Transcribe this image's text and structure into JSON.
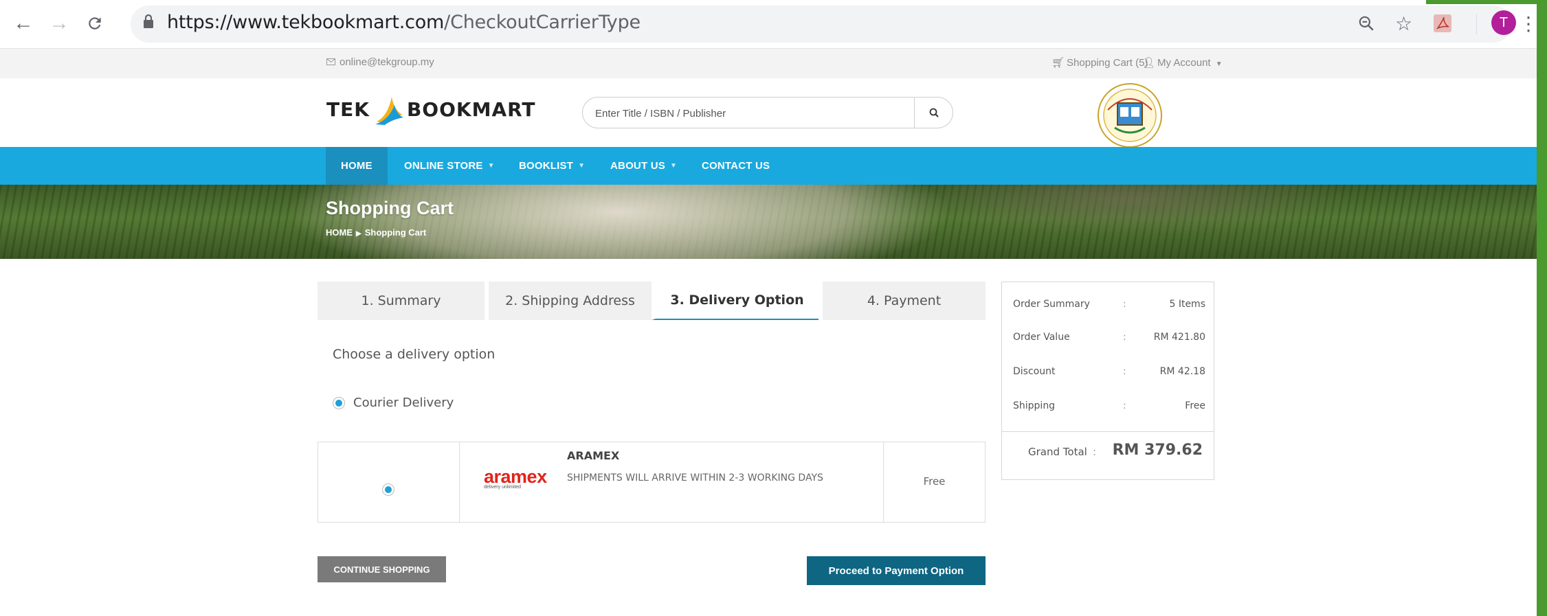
{
  "browser": {
    "url_host": "https://www.tekbookmart.com",
    "url_path": "/CheckoutCarrierType",
    "avatar_letter": "T"
  },
  "topbar": {
    "email": "online@tekgroup.my",
    "cart_link": "Shopping Cart (5)",
    "account_link": "My Account"
  },
  "header": {
    "logo_text_left": "TEK",
    "logo_text_right": "BOOKMART",
    "search_placeholder": "Enter Title / ISBN / Publisher"
  },
  "nav": {
    "items": [
      {
        "label": "HOME",
        "dropdown": false
      },
      {
        "label": "ONLINE STORE",
        "dropdown": true
      },
      {
        "label": "BOOKLIST",
        "dropdown": true
      },
      {
        "label": "ABOUT US",
        "dropdown": true
      },
      {
        "label": "CONTACT US",
        "dropdown": false
      }
    ]
  },
  "banner": {
    "title": "Shopping Cart",
    "crumb_home": "HOME",
    "crumb_current": "Shopping Cart"
  },
  "steps": [
    {
      "label": "1. Summary",
      "active": false
    },
    {
      "label": "2. Shipping Address",
      "active": false
    },
    {
      "label": "3. Delivery Option",
      "active": true
    },
    {
      "label": "4. Payment",
      "active": false
    }
  ],
  "delivery": {
    "heading": "Choose a delivery option",
    "option_label": "Courier Delivery",
    "carrier": {
      "logo_word": "aramex",
      "logo_tagline": "delivery unlimited",
      "name": "ARAMEX",
      "description": "SHIPMENTS WILL ARRIVE WITHIN 2-3 WORKING DAYS",
      "price": "Free"
    }
  },
  "buttons": {
    "continue": "CONTINUE SHOPPING",
    "proceed": "Proceed to Payment Option"
  },
  "summary": {
    "rows": [
      {
        "label": "Order Summary",
        "value": "5 Items"
      },
      {
        "label": "Order Value",
        "value": "RM 421.80"
      },
      {
        "label": "Discount",
        "value": "RM 42.18"
      },
      {
        "label": "Shipping",
        "value": "Free"
      }
    ],
    "colon": ":",
    "grand_label": "Grand Total",
    "grand_value": "RM 379.62"
  },
  "colors": {
    "nav_bg": "#19a9de",
    "nav_active": "#1b8fbe",
    "proceed_btn": "#0e6682",
    "continue_btn": "#7a7a7a",
    "aramex_red": "#e2231a"
  }
}
